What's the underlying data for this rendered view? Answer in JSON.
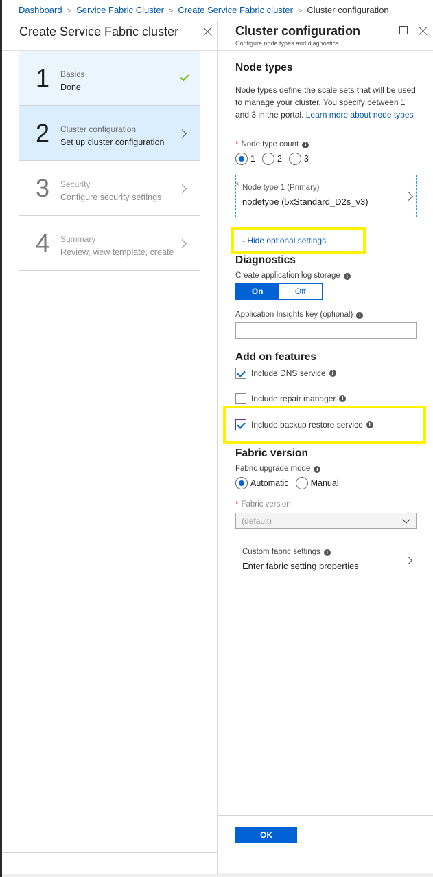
{
  "breadcrumb": {
    "items": [
      "Dashboard",
      "Service Fabric Cluster",
      "Create Service Fabric cluster"
    ],
    "current": "Cluster configuration"
  },
  "left_blade": {
    "title": "Create Service Fabric cluster",
    "steps": [
      {
        "number": "1",
        "title": "Basics",
        "subtitle": "Done",
        "state": "done"
      },
      {
        "number": "2",
        "title": "Cluster configuration",
        "subtitle": "Set up cluster configuration",
        "state": "active"
      },
      {
        "number": "3",
        "title": "Security",
        "subtitle": "Configure security settings",
        "state": "disabled"
      },
      {
        "number": "4",
        "title": "Summary",
        "subtitle": "Review, view template, create",
        "state": "disabled"
      }
    ]
  },
  "right_blade": {
    "title": "Cluster configuration",
    "subtitle": "Configure node types and diagnostics",
    "node_types": {
      "heading": "Node types",
      "description": "Node types define the scale sets that will be used to manage your cluster. You specify between 1 and 3 in the portal.",
      "learn_more": "Learn more about node types",
      "count_label": "Node type count",
      "count_options": [
        "1",
        "2",
        "3"
      ],
      "count_selected": "1",
      "node_type_1_label": "Node type 1 (Primary)",
      "node_type_1_value": "nodetype (5xStandard_D2s_v3)"
    },
    "optional_toggle_link": "- Hide optional settings",
    "diagnostics": {
      "heading": "Diagnostics",
      "log_storage_label": "Create application log storage",
      "toggle_on": "On",
      "toggle_off": "Off",
      "toggle_value": "On",
      "insights_label": "Application Insights key (optional)",
      "insights_value": "",
      "insights_placeholder": ""
    },
    "add_on": {
      "heading": "Add on features",
      "items": [
        {
          "label": "Include DNS service",
          "checked": true
        },
        {
          "label": "Include repair manager",
          "checked": false
        },
        {
          "label": "Include backup restore service",
          "checked": true
        }
      ]
    },
    "fabric": {
      "heading": "Fabric version",
      "upgrade_mode_label": "Fabric upgrade mode",
      "upgrade_options": [
        "Automatic",
        "Manual"
      ],
      "upgrade_selected": "Automatic",
      "version_label": "Fabric version",
      "version_value": "(default)",
      "custom_settings_label": "Custom fabric settings",
      "custom_settings_value": "Enter fabric setting properties"
    },
    "ok_label": "OK"
  },
  "colors": {
    "accent": "#0062d4",
    "link": "#0058ad",
    "highlight": "#fff200",
    "check_done": "#7fba00",
    "required": "#c4262e"
  }
}
